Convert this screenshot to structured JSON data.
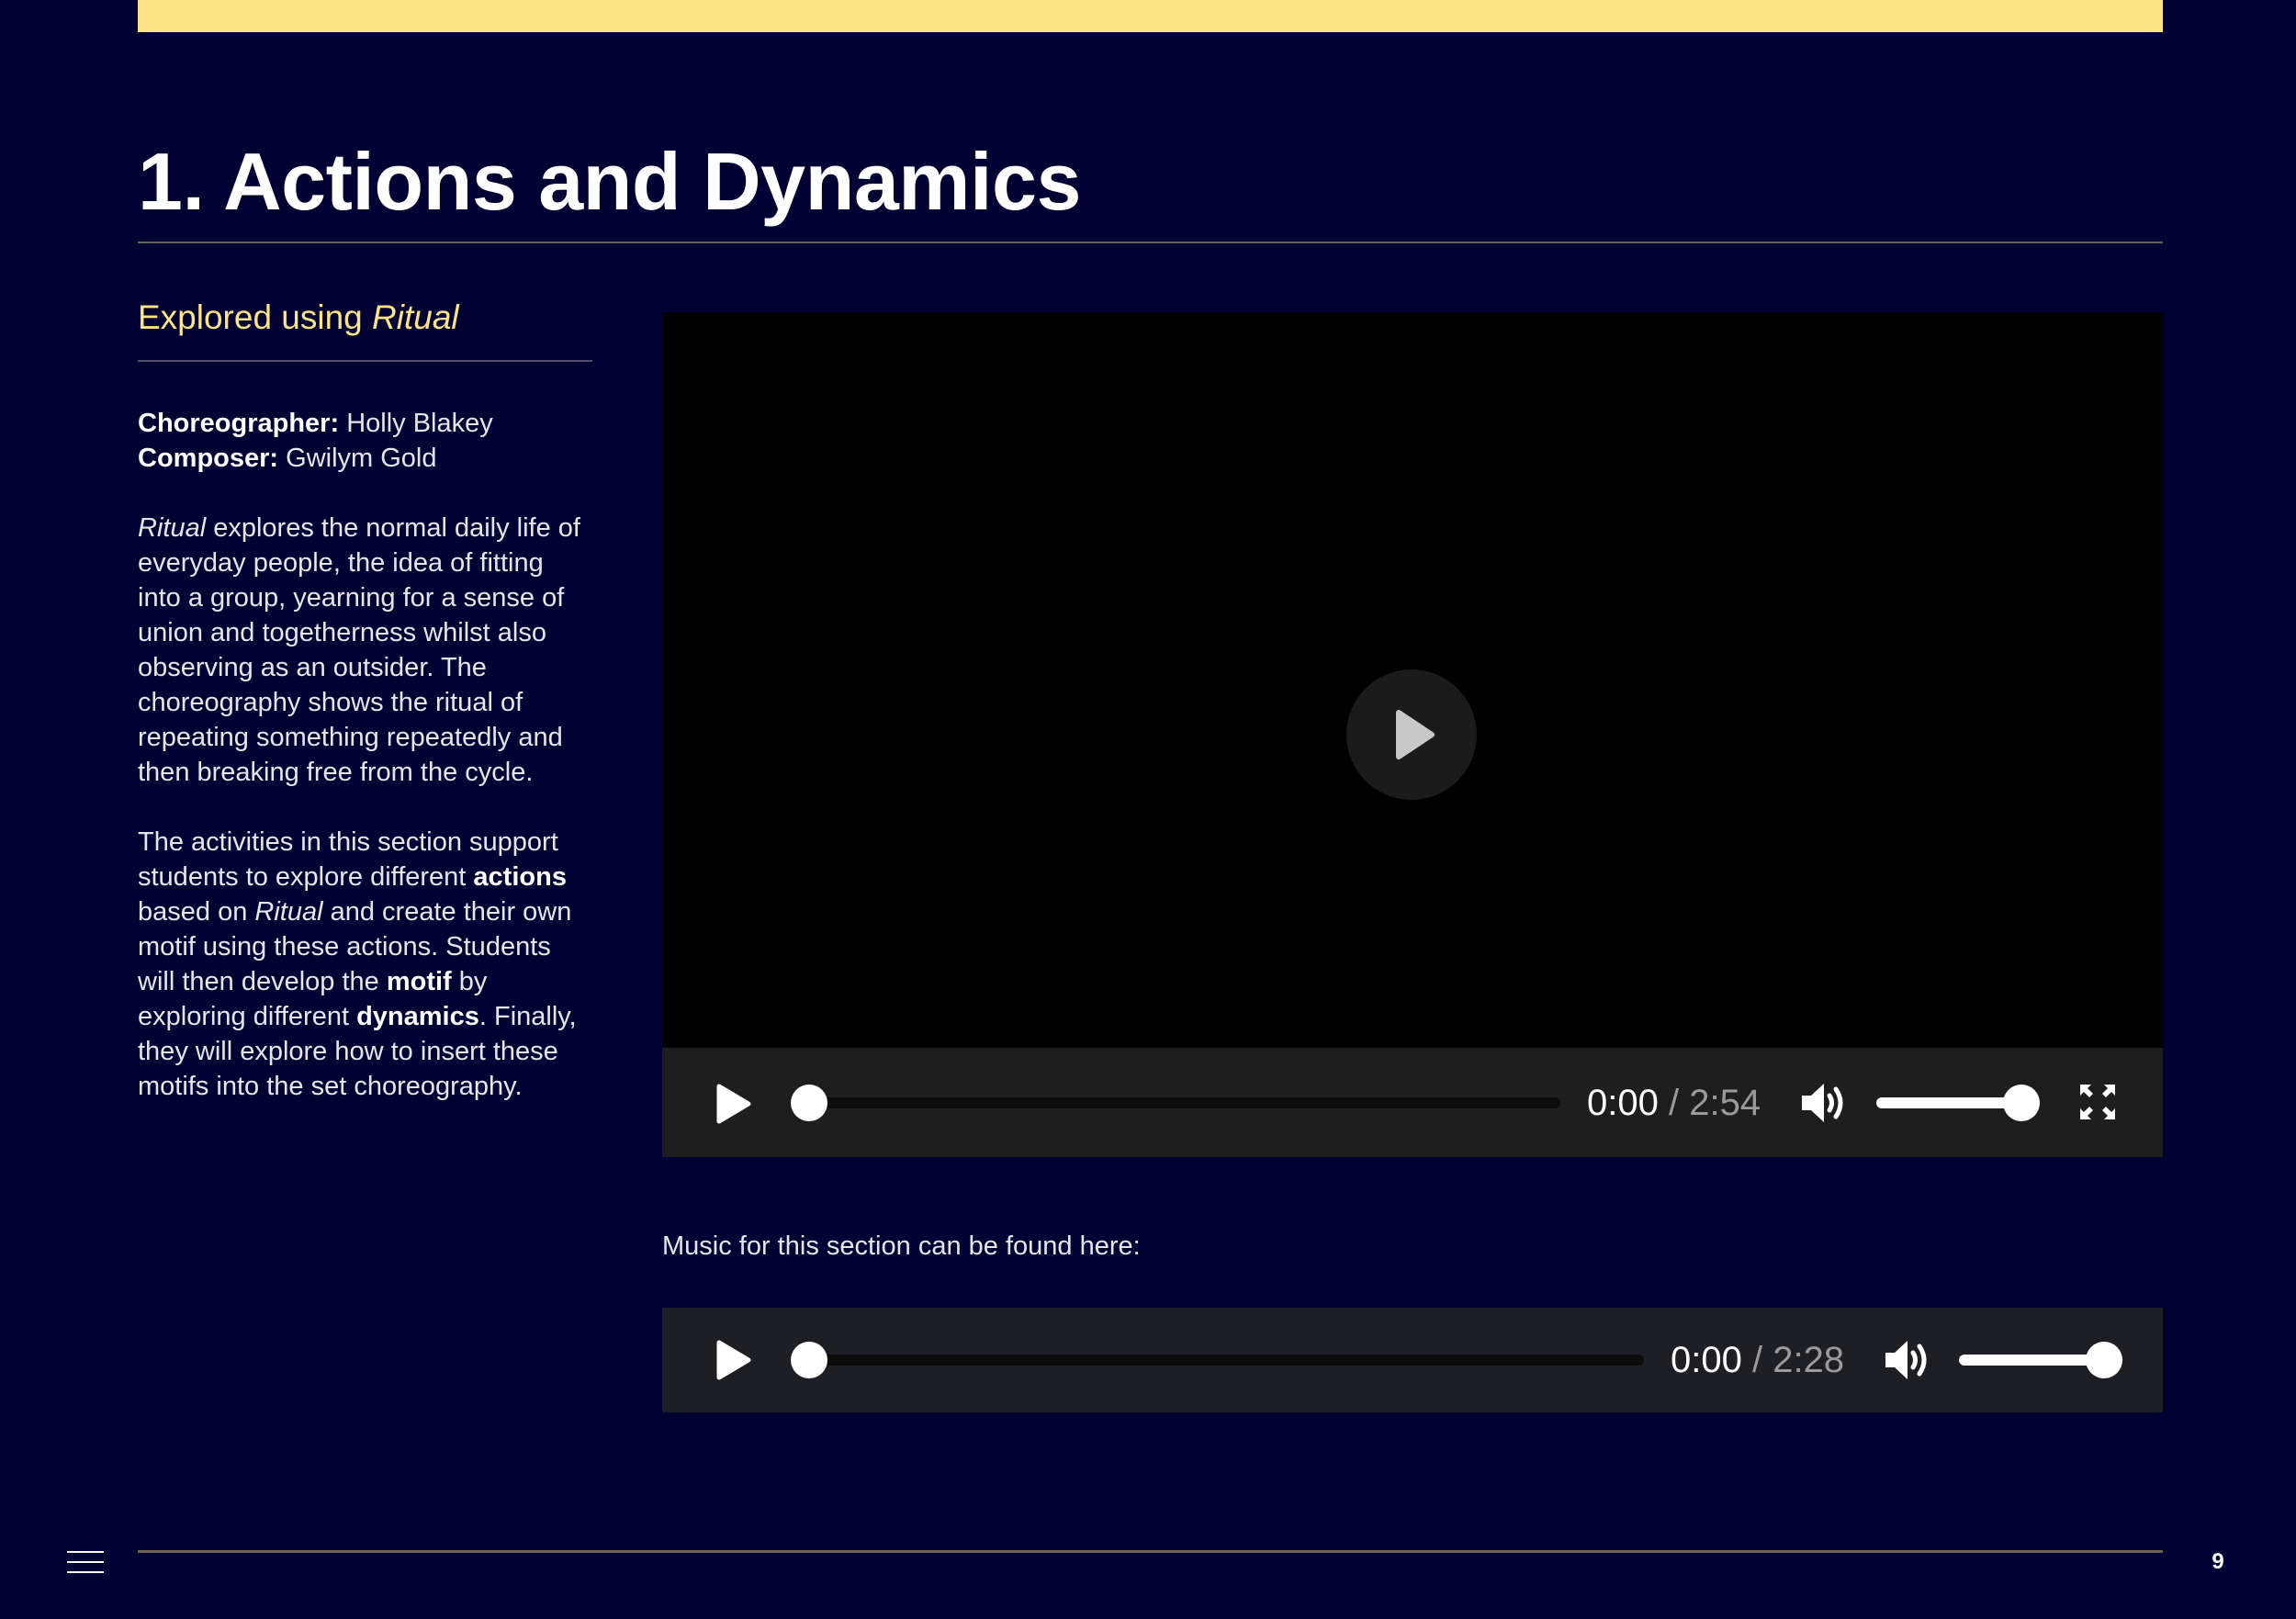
{
  "heading": "1. Actions and Dynamics",
  "sidebar": {
    "subtitle_prefix": "Explored using ",
    "subtitle_work": "Ritual",
    "choreographer_label": "Choreographer:",
    "choreographer": " Holly Blakey",
    "composer_label": "Composer:",
    "composer": " Gwilym Gold",
    "p1_work": "Ritual",
    "p1_text": " explores the normal daily life of everyday people, the idea of fitting into a group, yearning for a sense of union and togetherness whilst also observing as an outsider. The choreography shows the ritual of repeating something repeatedly and then breaking free from the cycle.",
    "p2_a": "The activities in this section support students to explore different ",
    "p2_b": "actions",
    "p2_c": " based on ",
    "p2_d": "Ritual",
    "p2_e": " and create their own motif using these actions. Students will then develop the ",
    "p2_f": "motif",
    "p2_g": " by exploring different ",
    "p2_h": "dynamics",
    "p2_i": ". Finally, they will explore how to insert these motifs into the set choreography."
  },
  "video_player": {
    "current_time": "0:00",
    "separator": " / ",
    "duration": "2:54",
    "progress": 0,
    "volume": 1.0
  },
  "music_label": "Music for this section can be found here:",
  "audio_player": {
    "current_time": "0:00",
    "separator": " / ",
    "duration": "2:28",
    "progress": 0,
    "volume": 1.0
  },
  "footer": {
    "page_number": "9"
  },
  "colors": {
    "background": "#000033",
    "accent_yellow": "#fce385",
    "rule": "#6b6552",
    "player_bar": "#1e1e1e"
  }
}
